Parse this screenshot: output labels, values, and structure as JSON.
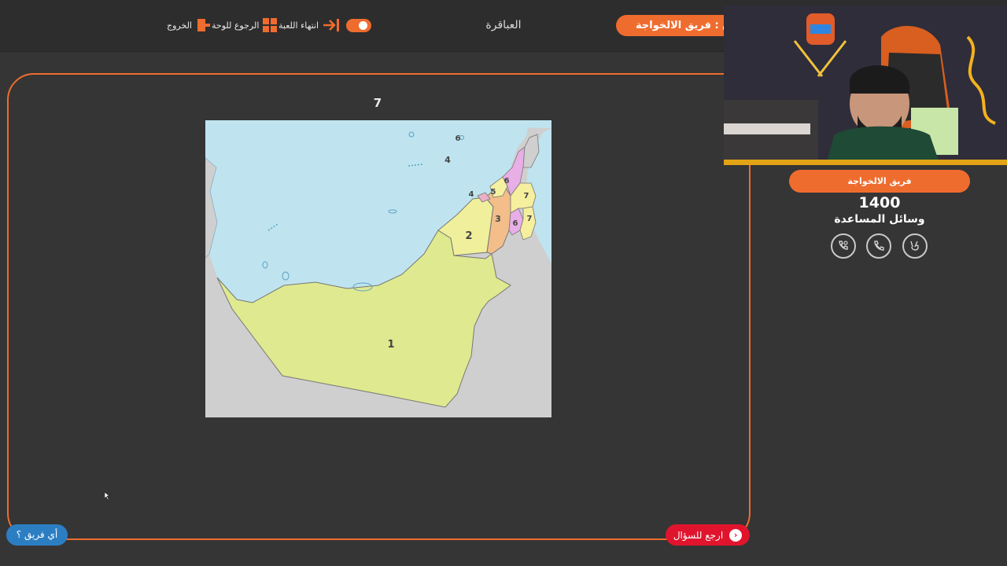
{
  "header": {
    "nav": {
      "exit_label": "الخروج",
      "back_to_board_label": "الرجوع للوحة",
      "end_game_label": "انتهاء اللعبة"
    },
    "category": "العباقرة",
    "turn_team": "ق : فريق الالخواجة"
  },
  "question": {
    "number": "7",
    "map_labels": [
      "1",
      "2",
      "3",
      "4",
      "4",
      "5",
      "6",
      "6",
      "6",
      "7",
      "7"
    ]
  },
  "side_panel": {
    "team_name": "فريق الالخواجة",
    "score": "1400",
    "aids_title": "وسائل المساعدة",
    "aids": [
      "two-phones-icon",
      "phone-icon",
      "victory-hand-icon"
    ]
  },
  "footer": {
    "back_to_question_label": "ارجع للسؤال",
    "which_team_label": "أي فريق ؟"
  },
  "colors": {
    "accent": "#ef6c2f",
    "background": "#353535",
    "back_button": "#e0152d",
    "which_team_button": "#2c7ec3"
  }
}
